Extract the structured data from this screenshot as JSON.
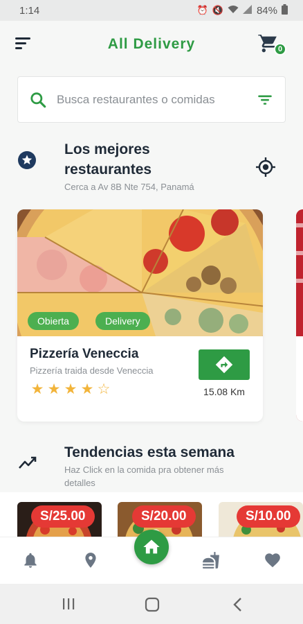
{
  "status_bar": {
    "time": "1:14",
    "battery": "84%"
  },
  "header": {
    "title": "All Delivery",
    "cart_count": "0"
  },
  "search": {
    "placeholder": "Busca restaurantes o comidas"
  },
  "best_section": {
    "title_line1": "Los mejores",
    "title_line2": "restaurantes",
    "subtitle": "Cerca a Av 8B Nte 754, Panamá"
  },
  "restaurant_card": {
    "tag_open": "Obierta",
    "tag_delivery": "Delivery",
    "name": "Pizzería Veneccia",
    "description": "Pizzería traida desde Veneccia",
    "rating": 4,
    "rating_max": 5,
    "distance": "15.08 Km"
  },
  "trend_section": {
    "title": "Tendencias esta semana",
    "subtitle_line1": "Haz Click en la comida pra obtener más",
    "subtitle_line2": "detalles"
  },
  "trend_items": [
    {
      "price": "S/25.00"
    },
    {
      "price": "S/20.00"
    },
    {
      "price": "S/10.00"
    }
  ],
  "bottom_nav": [
    "bell-icon",
    "location-pin-icon",
    "home-icon",
    "fast-food-icon",
    "heart-icon"
  ],
  "colors": {
    "brand_green": "#2e9b44",
    "price_red": "#e53935",
    "star": "#f2b43a"
  }
}
